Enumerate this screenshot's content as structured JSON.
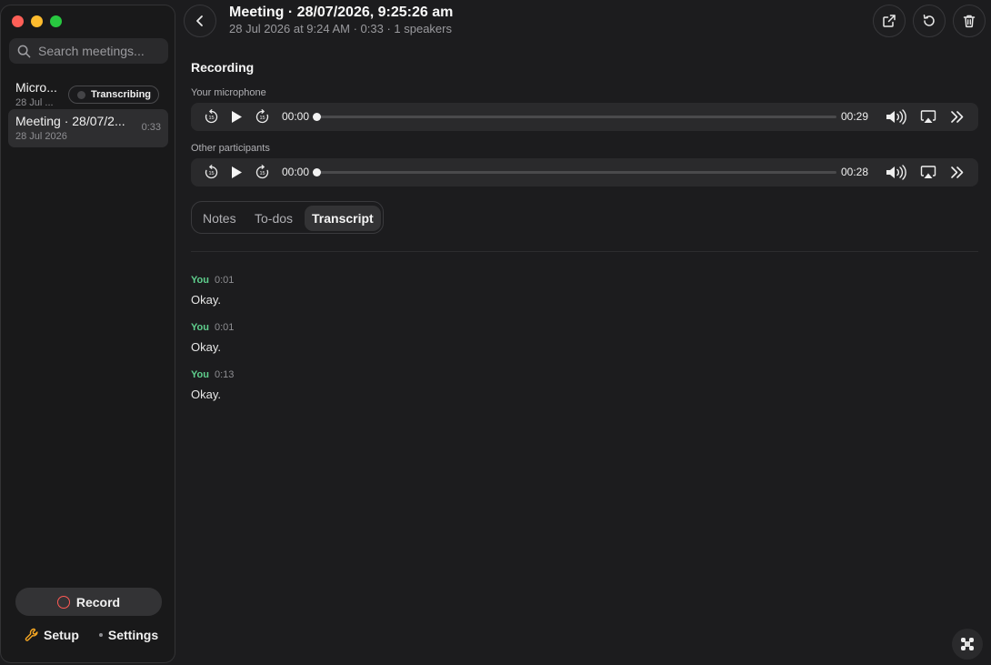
{
  "sidebar": {
    "search_placeholder": "Search meetings...",
    "meetings": [
      {
        "title": "Micro...",
        "date": "28 Jul ...",
        "badge": "Transcribing"
      },
      {
        "title": "Meeting · 28/07/2...",
        "date": "28 Jul 2026",
        "duration": "0:33"
      }
    ],
    "record_label": "Record",
    "setup_label": "Setup",
    "settings_label": "Settings"
  },
  "header": {
    "title": "Meeting · 28/07/2026, 9:25:26 am",
    "subtitle": "28 Jul 2026 at 9:24 AM · 0:33 · 1 speakers"
  },
  "recording": {
    "section_title": "Recording",
    "tracks": [
      {
        "label": "Your microphone",
        "current": "00:00",
        "duration": "00:29",
        "progress": 0
      },
      {
        "label": "Other participants",
        "current": "00:00",
        "duration": "00:28",
        "progress": 0
      }
    ]
  },
  "tabs": [
    {
      "label": "Notes",
      "active": false
    },
    {
      "label": "To-dos",
      "active": false
    },
    {
      "label": "Transcript",
      "active": true
    }
  ],
  "transcript": [
    {
      "speaker": "You",
      "time": "0:01",
      "text": "Okay."
    },
    {
      "speaker": "You",
      "time": "0:01",
      "text": "Okay."
    },
    {
      "speaker": "You",
      "time": "0:13",
      "text": "Okay."
    }
  ],
  "colors": {
    "speaker": "#5fcf8d",
    "record_accent": "#ff5a55",
    "setup_icon": "#f5a623"
  },
  "icons": {
    "back": "chevron-left-icon",
    "export": "external-link-icon",
    "refresh": "refresh-icon",
    "trash": "trash-icon"
  }
}
